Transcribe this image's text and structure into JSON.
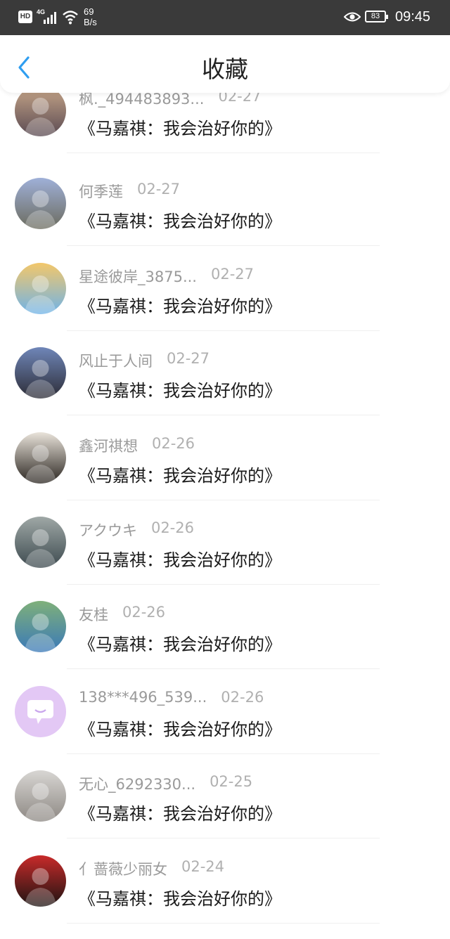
{
  "status_bar": {
    "hd": "HD",
    "network": "4G",
    "speed_value": "69",
    "speed_unit": "B/s",
    "battery": "83",
    "time": "09:45"
  },
  "header": {
    "title": "收藏",
    "back_icon": "chevron-left-icon",
    "accent_color": "#2f9ef0"
  },
  "favorites": [
    {
      "user": "枫._494483893...",
      "date": "02-27",
      "post": "《马嘉祺：我会治好你的》",
      "avatar_colors": [
        "#c9a88a",
        "#5a4a52"
      ]
    },
    {
      "user": "何季莲",
      "date": "02-27",
      "post": "《马嘉祺：我会治好你的》",
      "avatar_colors": [
        "#9fb0d8",
        "#6b6b5e"
      ]
    },
    {
      "user": "星途彼岸_3875...",
      "date": "02-27",
      "post": "《马嘉祺：我会治好你的》",
      "avatar_colors": [
        "#f3c76a",
        "#6fb3e8"
      ]
    },
    {
      "user": "风止于人间",
      "date": "02-27",
      "post": "《马嘉祺：我会治好你的》",
      "avatar_colors": [
        "#6f86b8",
        "#2c2c36"
      ]
    },
    {
      "user": "鑫河祺想",
      "date": "02-26",
      "post": "《马嘉祺：我会治好你的》",
      "avatar_colors": [
        "#e9e3da",
        "#2a2520"
      ]
    },
    {
      "user": "アクウキ",
      "date": "02-26",
      "post": "《马嘉祺：我会治好你的》",
      "avatar_colors": [
        "#9fa8a6",
        "#3d4a4f"
      ]
    },
    {
      "user": "友桂",
      "date": "02-26",
      "post": "《马嘉祺：我会治好你的》",
      "avatar_colors": [
        "#7fb07a",
        "#3a79b8"
      ]
    },
    {
      "user": "138***496_539...",
      "date": "02-26",
      "post": "《马嘉祺：我会治好你的》",
      "avatar_colors": [
        "#e3c8f5",
        "#e3c8f5"
      ]
    },
    {
      "user": "无心_6292330...",
      "date": "02-25",
      "post": "《马嘉祺：我会治好你的》",
      "avatar_colors": [
        "#d8d6d3",
        "#8d8883"
      ]
    },
    {
      "user": "亻蔷薇少丽女",
      "date": "02-24",
      "post": "《马嘉祺：我会治好你的》",
      "avatar_colors": [
        "#c82a2a",
        "#1c1412"
      ]
    }
  ]
}
